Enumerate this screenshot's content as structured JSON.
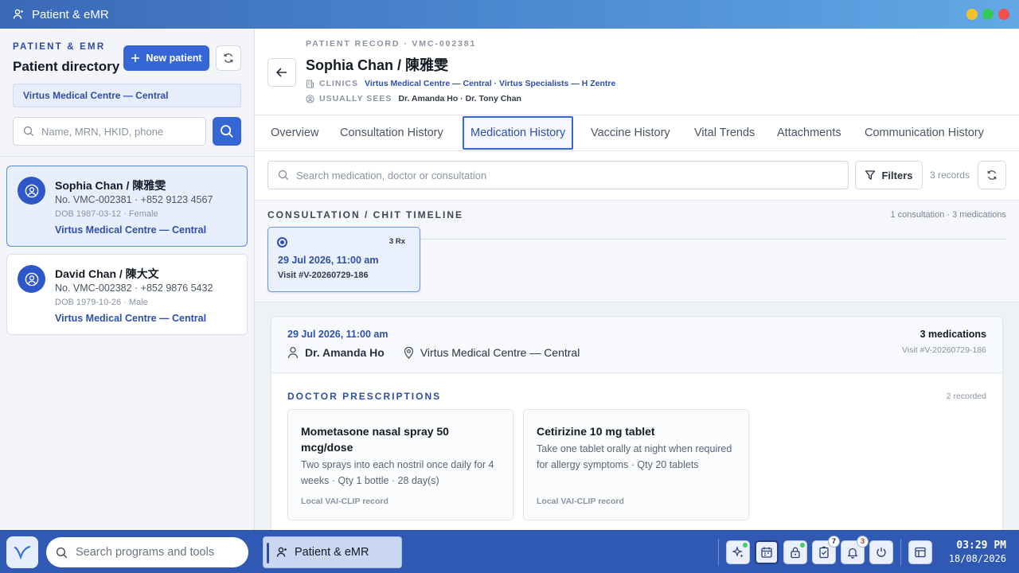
{
  "window": {
    "title": "Patient & eMR",
    "controls": {
      "minimize": "#f5c02d",
      "maximize": "#34c75a",
      "close": "#f0504b"
    }
  },
  "sidebar": {
    "kicker": "PATIENT & EMR",
    "title": "Patient directory",
    "new_patient_label": "New patient",
    "clinic_filter": "Virtus Medical Centre — Central",
    "search_placeholder": "Name, MRN, HKID, phone",
    "patients": [
      {
        "name": "Sophia Chan / 陳雅雯",
        "number": "No. VMC-002381 · +852 9123 4567",
        "dob": "DOB 1987-03-12 · Female",
        "clinic": "Virtus Medical Centre — Central",
        "selected": true
      },
      {
        "name": "David Chan / 陳大文",
        "number": "No. VMC-002382 · +852 9876 5432",
        "dob": "DOB 1979-10-26 · Male",
        "clinic": "Virtus Medical Centre — Central",
        "selected": false
      }
    ]
  },
  "record": {
    "kicker": "PATIENT RECORD · VMC-002381",
    "name": "Sophia Chan / 陳雅雯",
    "clinics_label": "CLINICS",
    "clinics_value": "Virtus Medical Centre — Central · Virtus Specialists — H Zentre",
    "sees_label": "USUALLY SEES",
    "sees_value": "Dr. Amanda Ho · Dr. Tony Chan"
  },
  "tabs": [
    {
      "label": "Overview",
      "active": false
    },
    {
      "label": "Consultation History",
      "active": false
    },
    {
      "label": "Medication History",
      "active": true
    },
    {
      "label": "Vaccine History",
      "active": false
    },
    {
      "label": "Vital Trends",
      "active": false
    },
    {
      "label": "Attachments",
      "active": false
    },
    {
      "label": "Communication History",
      "active": false
    }
  ],
  "filterbar": {
    "search_placeholder": "Search medication, doctor or consultation",
    "filters_label": "Filters",
    "record_count": "3 records"
  },
  "timeline": {
    "title": "CONSULTATION / CHIT TIMELINE",
    "summary": "1 consultation · 3 medications",
    "card": {
      "rx": "3 Rx",
      "date": "29 Jul 2026, 11:00 am",
      "visit": "Visit #V-20260729-186"
    }
  },
  "consultation": {
    "date": "29 Jul 2026, 11:00 am",
    "doctor": "Dr. Amanda Ho",
    "clinic": "Virtus Medical Centre — Central",
    "count": "3 medications",
    "visit": "Visit #V-20260729-186",
    "prescriptions_title": "DOCTOR PRESCRIPTIONS",
    "prescriptions_recorded": "2 recorded",
    "prescriptions": [
      {
        "name": "Mometasone nasal spray 50 mcg/dose",
        "desc": "Two sprays into each nostril once daily for 4 weeks · Qty 1 bottle · 28 day(s)",
        "source": "Local VAI-CLIP record"
      },
      {
        "name": "Cetirizine 10 mg tablet",
        "desc": "Take one tablet orally at night when required for allergy symptoms · Qty 20 tablets",
        "source": "Local VAI-CLIP record"
      }
    ]
  },
  "taskbar": {
    "search_placeholder": "Search programs and tools",
    "active_app": "Patient & eMR",
    "tray": [
      {
        "icon": "sparkle-icon",
        "badge": ""
      },
      {
        "icon": "calendar-icon",
        "badge": ""
      },
      {
        "icon": "lock-icon",
        "badge": ""
      },
      {
        "icon": "tasks-icon",
        "badge": "7"
      },
      {
        "icon": "bell-icon",
        "badge": "3"
      },
      {
        "icon": "power-icon",
        "badge": ""
      },
      {
        "icon": "layout-icon",
        "badge": ""
      }
    ],
    "time": "03:29 PM",
    "date": "18/08/2026"
  }
}
